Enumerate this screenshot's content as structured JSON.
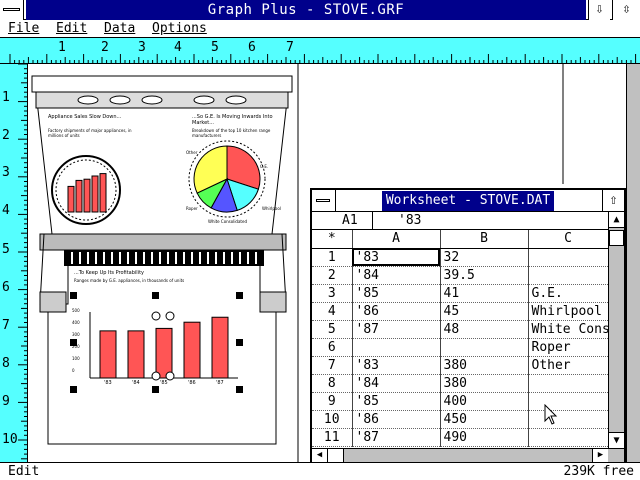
{
  "window": {
    "title": "Graph Plus - STOVE.GRF",
    "minimize_glyph": "⇩",
    "maximize_glyph": "⇳"
  },
  "menu": {
    "items": [
      "File",
      "Edit",
      "Data",
      "Options"
    ]
  },
  "ruler": {
    "h_labels": [
      "1",
      "2",
      "3",
      "4",
      "5",
      "6",
      "7"
    ],
    "v_labels": [
      "1",
      "2",
      "3",
      "4",
      "5",
      "6",
      "7",
      "8",
      "9",
      "10"
    ]
  },
  "document": {
    "panel1_title": "Appliance Sales Slow Down...",
    "panel1_sub": "Factory shipments of major appliances, in millions of units",
    "panel2_title": "...So G.E. Is Moving Inwards Into Market...",
    "panel2_sub": "Breakdown of the top 10 kitchen range manufacturers",
    "pie_labels": [
      "Other",
      "Whirlpool",
      "Roper",
      "White Consolidated",
      "G.E."
    ],
    "panel3_title": "...To Keep Up Its Profitability",
    "panel3_sub": "Ranges made by G.E. appliances, in thousands of units",
    "bar_axis": [
      "500",
      "400",
      "300",
      "200",
      "100",
      "0"
    ],
    "bar_cats": [
      "'83",
      "'84",
      "'85",
      "'86",
      "'87"
    ],
    "colors": {
      "bar": "#ff5555",
      "pie_ge": "#ff5555",
      "pie_whirlpool": "#55ffff",
      "pie_roper": "#55ff55",
      "pie_white": "#5555ff",
      "pie_other": "#ffff55"
    }
  },
  "chart_data": [
    {
      "type": "bar",
      "categories": [
        "'83",
        "'84",
        "'85",
        "'86",
        "'87"
      ],
      "values": [
        32,
        39.5,
        41,
        45,
        48
      ],
      "title": "Appliance Sales Slow Down..."
    },
    {
      "type": "pie",
      "categories": [
        "G.E.",
        "Whirlpool",
        "White Consolidated",
        "Roper",
        "Other"
      ],
      "title": "...So G.E. Is Moving Inwards Into Market..."
    },
    {
      "type": "bar",
      "categories": [
        "'83",
        "'84",
        "'85",
        "'86",
        "'87"
      ],
      "values": [
        380,
        380,
        400,
        450,
        490
      ],
      "title": "...To Keep Up Its Profitability",
      "ylim": [
        0,
        500
      ]
    }
  ],
  "worksheet": {
    "title": "Worksheet - STOVE.DAT",
    "cell_ref": "A1",
    "cell_value": "'83",
    "columns": [
      "*",
      "A",
      "B",
      "C"
    ],
    "rows": [
      [
        "1",
        "'83",
        "32",
        ""
      ],
      [
        "2",
        "'84",
        "39.5",
        ""
      ],
      [
        "3",
        "'85",
        "41",
        "G.E."
      ],
      [
        "4",
        "'86",
        "45",
        "Whirlpool"
      ],
      [
        "5",
        "'87",
        "48",
        "White Cons"
      ],
      [
        "6",
        "",
        "",
        "Roper"
      ],
      [
        "7",
        "'83",
        "380",
        "Other"
      ],
      [
        "8",
        "'84",
        "380",
        ""
      ],
      [
        "9",
        "'85",
        "400",
        ""
      ],
      [
        "10",
        "'86",
        "450",
        ""
      ],
      [
        "11",
        "'87",
        "490",
        ""
      ]
    ]
  },
  "status": {
    "mode": "Edit",
    "memory": "239K free"
  }
}
